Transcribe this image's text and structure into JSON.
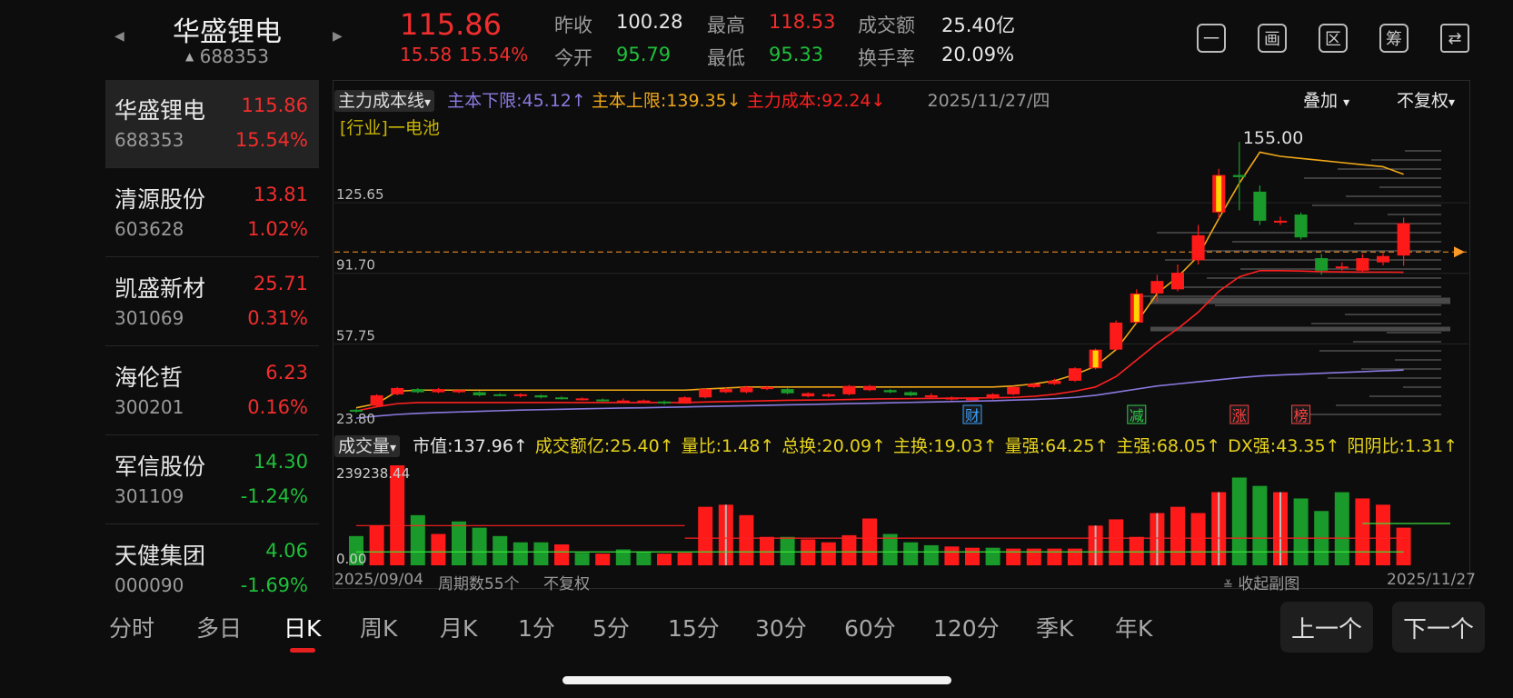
{
  "header": {
    "prev_arrow": "◀",
    "next_arrow": "▶",
    "name": "华盛锂电",
    "code": "688353",
    "code_marker": "▲",
    "price": "115.86",
    "change": "15.58",
    "change_pct": "15.54%",
    "stats": [
      {
        "label": "昨收",
        "value": "100.28",
        "color": "white"
      },
      {
        "label": "最高",
        "value": "118.53",
        "color": "red"
      },
      {
        "label": "成交额",
        "value": "25.40亿",
        "color": "white"
      },
      {
        "label": "今开",
        "value": "95.79",
        "color": "green"
      },
      {
        "label": "最低",
        "value": "95.33",
        "color": "green"
      },
      {
        "label": "换手率",
        "value": "20.09%",
        "color": "white"
      }
    ],
    "icons": [
      {
        "name": "minus-box-icon",
        "glyph": "一"
      },
      {
        "name": "draw-icon",
        "glyph": "画"
      },
      {
        "name": "region-icon",
        "glyph": "区"
      },
      {
        "name": "chips-icon",
        "glyph": "筹"
      },
      {
        "name": "rotate-screen-icon",
        "glyph": "⇄"
      }
    ]
  },
  "watchlist": [
    {
      "name": "华盛锂电",
      "price": "115.86",
      "code": "688353",
      "pct": "15.54%",
      "dir": "up"
    },
    {
      "name": "清源股份",
      "price": "13.81",
      "code": "603628",
      "pct": "1.02%",
      "dir": "up"
    },
    {
      "name": "凯盛新材",
      "price": "25.71",
      "code": "301069",
      "pct": "0.31%",
      "dir": "up"
    },
    {
      "name": "海伦哲",
      "price": "6.23",
      "code": "300201",
      "pct": "0.16%",
      "dir": "up"
    },
    {
      "name": "军信股份",
      "price": "14.30",
      "code": "301109",
      "pct": "-1.24%",
      "dir": "down"
    },
    {
      "name": "天健集团",
      "price": "4.06",
      "code": "000090",
      "pct": "-1.69%",
      "dir": "down"
    }
  ],
  "main_chart": {
    "indicator_dropdown": "主力成本线",
    "dropdown_arrow": "▾",
    "lower_limit": "主本下限:45.12↑",
    "upper_limit": "主本上限:139.35↓",
    "main_cost": "主力成本:92.24↓",
    "date": "2025/11/27/四",
    "overlay_dropdown": "叠加",
    "adjust_dropdown": "不复权",
    "industry_label": "[行业]一电池",
    "y_labels": [
      "155.00",
      "125.65",
      "91.70",
      "57.75",
      "23.80"
    ],
    "event_badges": [
      "财",
      "减",
      "涨",
      "榜"
    ],
    "colors": {
      "up": "#ff1a1a",
      "down": "#1a9a2a",
      "cost": "#ff2020",
      "upper": "#f0a818",
      "lower": "#8a7ae0",
      "signal": "#ffd400"
    }
  },
  "chart_data": {
    "type": "candlestick",
    "ylim": [
      23.8,
      155.0
    ],
    "candles": [
      [
        25.5,
        26.0,
        24.5,
        26.5,
        "down"
      ],
      [
        28.0,
        33.0,
        27.5,
        33.5,
        "up"
      ],
      [
        33.5,
        36.5,
        33.0,
        37.0,
        "up"
      ],
      [
        36.0,
        34.5,
        34.0,
        36.5,
        "down"
      ],
      [
        34.5,
        36.0,
        34.0,
        36.5,
        "up"
      ],
      [
        35.5,
        34.5,
        34.0,
        36.0,
        "up"
      ],
      [
        34.5,
        33.0,
        32.5,
        35.0,
        "down"
      ],
      [
        33.0,
        33.5,
        32.5,
        34.0,
        "down"
      ],
      [
        33.5,
        33.0,
        32.0,
        34.0,
        "up"
      ],
      [
        33.0,
        32.0,
        31.5,
        33.5,
        "down"
      ],
      [
        32.0,
        31.5,
        31.0,
        32.5,
        "down"
      ],
      [
        31.5,
        31.0,
        30.5,
        32.0,
        "up"
      ],
      [
        31.0,
        30.5,
        30.0,
        31.5,
        "down"
      ],
      [
        30.5,
        30.5,
        29.5,
        31.5,
        "up"
      ],
      [
        30.5,
        30.0,
        29.5,
        31.0,
        "up"
      ],
      [
        30.0,
        29.5,
        28.5,
        30.5,
        "down"
      ],
      [
        29.0,
        32.0,
        29.0,
        32.5,
        "up"
      ],
      [
        32.0,
        36.0,
        31.5,
        36.5,
        "up"
      ],
      [
        36.0,
        34.5,
        34.0,
        37.0,
        "up"
      ],
      [
        34.5,
        37.0,
        34.0,
        37.5,
        "up"
      ],
      [
        37.0,
        36.0,
        35.5,
        37.5,
        "up"
      ],
      [
        36.0,
        34.0,
        33.5,
        36.5,
        "down"
      ],
      [
        34.0,
        32.5,
        32.0,
        34.5,
        "up"
      ],
      [
        32.5,
        33.5,
        32.0,
        34.0,
        "up"
      ],
      [
        33.5,
        37.5,
        33.0,
        38.0,
        "up"
      ],
      [
        37.5,
        35.5,
        35.0,
        38.0,
        "up"
      ],
      [
        35.5,
        34.5,
        34.0,
        36.0,
        "down"
      ],
      [
        34.5,
        33.0,
        32.5,
        35.0,
        "down"
      ],
      [
        33.0,
        32.0,
        31.5,
        34.0,
        "up"
      ],
      [
        32.0,
        31.0,
        30.5,
        32.5,
        "up"
      ],
      [
        31.0,
        31.5,
        30.5,
        32.0,
        "up"
      ],
      [
        31.5,
        33.5,
        31.0,
        34.0,
        "up"
      ],
      [
        33.5,
        37.0,
        33.0,
        37.5,
        "up"
      ],
      [
        37.0,
        38.5,
        36.5,
        39.0,
        "up"
      ],
      [
        38.5,
        40.0,
        38.0,
        41.0,
        "up"
      ],
      [
        40.0,
        46.0,
        39.5,
        46.5,
        "up"
      ],
      [
        46.0,
        55.0,
        45.5,
        55.5,
        "up"
      ],
      [
        55.0,
        68.0,
        54.5,
        69.0,
        "up"
      ],
      [
        68.0,
        82.0,
        67.5,
        84.0,
        "up"
      ],
      [
        82.0,
        88.0,
        78.0,
        91.0,
        "up"
      ],
      [
        84.0,
        92.0,
        83.0,
        96.0,
        "up"
      ],
      [
        98.0,
        110.0,
        96.0,
        115.0,
        "up"
      ],
      [
        121.0,
        139.0,
        118.0,
        142.0,
        "up"
      ],
      [
        139.0,
        138.0,
        122.0,
        155.0,
        "down"
      ],
      [
        131.0,
        117.0,
        115.0,
        134.0,
        "down"
      ],
      [
        117.0,
        117.0,
        115.0,
        119.0,
        "up"
      ],
      [
        120.0,
        109.0,
        108.0,
        121.0,
        "down"
      ],
      [
        99.0,
        93.0,
        91.0,
        101.0,
        "down"
      ],
      [
        95.0,
        94.5,
        93.0,
        97.0,
        "up"
      ],
      [
        93.0,
        99.0,
        92.5,
        101.0,
        "up"
      ],
      [
        97.0,
        100.0,
        95.5,
        101.5,
        "up"
      ],
      [
        100.28,
        115.86,
        95.33,
        118.53,
        "up"
      ]
    ],
    "main_cost_line": [
      25.5,
      27.5,
      29.0,
      29.5,
      29.5,
      29.5,
      29.5,
      29.5,
      29.5,
      29.5,
      29.5,
      29.5,
      29.5,
      29.5,
      29.5,
      29.5,
      29.5,
      29.8,
      30.0,
      30.2,
      30.4,
      30.6,
      30.7,
      30.8,
      31.0,
      31.2,
      31.3,
      31.4,
      31.5,
      31.6,
      31.7,
      31.8,
      32.0,
      32.5,
      33.5,
      35.0,
      37.0,
      42.0,
      50.0,
      58.0,
      65.0,
      73.0,
      83.0,
      90.0,
      93.0,
      93.0,
      92.8,
      92.5,
      92.4,
      92.3,
      92.3,
      92.24
    ],
    "upper_line": [
      27.0,
      29.0,
      35.0,
      35.5,
      35.5,
      35.5,
      35.5,
      35.5,
      35.5,
      35.5,
      35.5,
      35.5,
      35.5,
      35.5,
      35.5,
      35.5,
      35.5,
      36.0,
      36.5,
      37.0,
      37.0,
      37.0,
      37.0,
      37.0,
      37.0,
      37.0,
      37.0,
      37.0,
      37.0,
      37.0,
      37.0,
      37.0,
      37.5,
      38.5,
      40.0,
      43.0,
      47.0,
      55.0,
      68.0,
      82.0,
      90.0,
      100.0,
      118.0,
      135.0,
      150.0,
      148.0,
      147.0,
      146.0,
      145.0,
      144.0,
      143.0,
      139.35
    ],
    "lower_line": [
      22.0,
      23.0,
      23.8,
      24.3,
      24.7,
      25.0,
      25.3,
      25.6,
      25.9,
      26.1,
      26.3,
      26.5,
      26.7,
      26.9,
      27.0,
      27.2,
      27.4,
      27.6,
      27.8,
      28.0,
      28.2,
      28.4,
      28.6,
      28.8,
      29.0,
      29.2,
      29.4,
      29.6,
      29.8,
      30.0,
      30.2,
      30.4,
      30.7,
      31.0,
      31.4,
      32.0,
      33.0,
      34.5,
      36.0,
      37.5,
      38.5,
      39.5,
      40.5,
      41.5,
      42.3,
      42.8,
      43.2,
      43.6,
      44.0,
      44.4,
      44.8,
      45.12
    ],
    "volume_ylim": [
      0,
      239238.44
    ],
    "volume_dir": [
      "down",
      "up",
      "up",
      "down",
      "up",
      "down",
      "down",
      "down",
      "down",
      "down",
      "up",
      "down",
      "up",
      "down",
      "down",
      "up",
      "up",
      "up",
      "up",
      "up",
      "up",
      "down",
      "up",
      "up",
      "up",
      "up",
      "down",
      "down",
      "down",
      "up",
      "up",
      "down",
      "up",
      "up",
      "up",
      "up",
      "up",
      "up",
      "up",
      "up",
      "up",
      "up",
      "up",
      "down",
      "down",
      "up",
      "down",
      "down",
      "down",
      "up",
      "up",
      "up"
    ],
    "volumes": [
      70000,
      95000,
      239238,
      120000,
      75000,
      105000,
      90000,
      70000,
      55000,
      55000,
      50000,
      30000,
      28000,
      38000,
      33000,
      28000,
      30000,
      140000,
      145000,
      120000,
      68000,
      68000,
      62000,
      55000,
      72000,
      112000,
      75000,
      55000,
      48000,
      45000,
      42000,
      42000,
      40000,
      40000,
      40000,
      40000,
      95000,
      110000,
      68000,
      125000,
      140000,
      125000,
      175000,
      210000,
      190000,
      175000,
      160000,
      130000,
      175000,
      160000,
      145000,
      90000,
      125000,
      225000
    ],
    "volume_extra_bars": [
      175000,
      230000
    ]
  },
  "sub_chart": {
    "dropdown": "成交量",
    "dropdown_arrow": "▾",
    "metrics": [
      {
        "text": "市值:137.96↑",
        "color": "white"
      },
      {
        "text": "成交额亿:25.40↑",
        "color": "yellow"
      },
      {
        "text": "量比:1.48↑",
        "color": "yellow"
      },
      {
        "text": "总换:20.09↑",
        "color": "yellow"
      },
      {
        "text": "主换:19.03↑",
        "color": "yellow"
      },
      {
        "text": "量强:64.25↑",
        "color": "yellow"
      },
      {
        "text": "主强:68.05↑",
        "color": "yellow"
      },
      {
        "text": "DX强:43.35↑",
        "color": "yellow"
      },
      {
        "text": "阳阴比:1.31↑",
        "color": "yellow"
      }
    ],
    "y_max_label": "239238.44",
    "y_min_label": "0.00"
  },
  "footer": {
    "start_date": "2025/09/04",
    "period_count": "周期数55个",
    "adjust": "不复权",
    "collapse": "收起副图",
    "collapse_icon": "≚",
    "end_date": "2025/11/27"
  },
  "period_tabs": [
    "分时",
    "多日",
    "日K",
    "周K",
    "月K",
    "1分",
    "5分",
    "15分",
    "30分",
    "60分",
    "120分",
    "季K",
    "年K"
  ],
  "active_tab": "日K",
  "prev_button": "上一个",
  "next_button": "下一个"
}
